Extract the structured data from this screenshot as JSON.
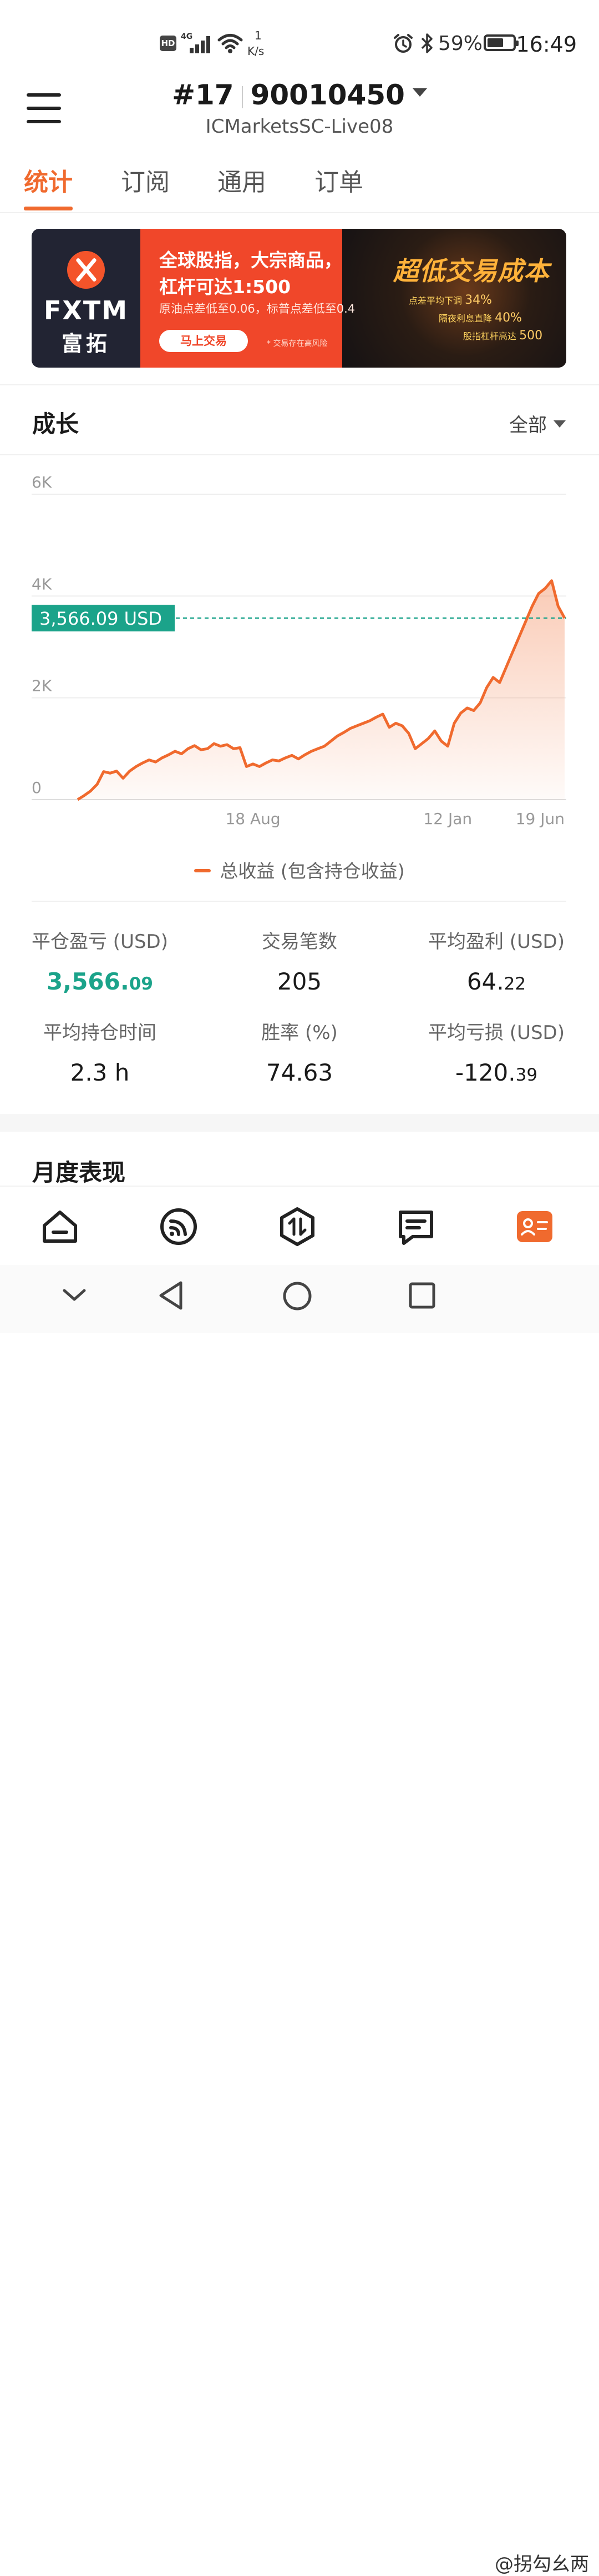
{
  "status_bar": {
    "network_hd": "HD",
    "network_type": "4G",
    "speed_value": "1",
    "speed_unit": "K/s",
    "battery": "59%",
    "time": "16:49"
  },
  "header": {
    "rank": "#17",
    "account_id": "90010450",
    "server": "ICMarketsSC-Live08"
  },
  "tabs": [
    {
      "label": "统计",
      "active": true
    },
    {
      "label": "订阅",
      "active": false
    },
    {
      "label": "通用",
      "active": false
    },
    {
      "label": "订单",
      "active": false
    }
  ],
  "banner": {
    "brand": "FXTM",
    "brand_cn": "富拓",
    "line1": "全球股指，大宗商品，",
    "line2": "杠杆可达1:500",
    "line3": "原油点差低至0.06，标普点差低至0.4",
    "button": "马上交易",
    "risk": "* 交易存在高风险",
    "headline": "超低交易成本",
    "promo": [
      {
        "text": "点差平均下调",
        "value": "34%"
      },
      {
        "text": "隔夜利息直降",
        "value": "40%"
      },
      {
        "text": "股指杠杆高达",
        "value": "500"
      }
    ]
  },
  "growth": {
    "title": "成长",
    "filter": "全部",
    "current_label": "3,566.09 USD",
    "legend": "总收益 (包含持仓收益)"
  },
  "chart_data": {
    "type": "area",
    "series": [
      {
        "name": "总收益 (包含持仓收益)",
        "color": "#f06a2e",
        "values": [
          0,
          80,
          170,
          300,
          550,
          520,
          560,
          420,
          560,
          650,
          720,
          780,
          740,
          820,
          880,
          950,
          900,
          1000,
          1060,
          980,
          1000,
          1100,
          1050,
          1080,
          1000,
          1020,
          650,
          700,
          650,
          720,
          780,
          760,
          820,
          870,
          800,
          880,
          950,
          1000,
          1050,
          1150,
          1250,
          1320,
          1400,
          1450,
          1500,
          1550,
          1620,
          1680,
          1420,
          1500,
          1450,
          1300,
          1000,
          1100,
          1200,
          1350,
          1150,
          1050,
          1500,
          1700,
          1800,
          1750,
          1900,
          2200,
          2400,
          2300,
          2600,
          2900,
          3200,
          3500,
          3800,
          4050,
          4150,
          4300,
          3800,
          3566.09
        ]
      }
    ],
    "x_tick_labels": [
      "18 Aug",
      "12 Jan",
      "19 Jun"
    ],
    "x_tick_index": [
      27,
      57,
      75
    ],
    "y_ticks": [
      0,
      2000,
      4000,
      6000
    ],
    "y_tick_labels": [
      "0",
      "2K",
      "4K",
      "6K"
    ],
    "ylim": [
      0,
      6000
    ],
    "current_value": 3566.09,
    "grid": true
  },
  "stats": [
    {
      "label": "平仓盈亏 (USD)",
      "int": "3,566.",
      "dec": "09",
      "green": true
    },
    {
      "label": "交易笔数",
      "int": "205",
      "dec": "",
      "green": false
    },
    {
      "label": "平均盈利 (USD)",
      "int": "64.",
      "dec": "22",
      "green": false
    },
    {
      "label": "平均持仓时间",
      "int": "2.3 h",
      "dec": "",
      "green": false
    },
    {
      "label": "胜率 (%)",
      "int": "74.63",
      "dec": "",
      "green": false
    },
    {
      "label": "平均亏损 (USD)",
      "int": "-120.",
      "dec": "39",
      "green": false
    }
  ],
  "monthly": {
    "title": "月度表现"
  },
  "bottom_nav": [
    {
      "name": "home-icon"
    },
    {
      "name": "signal-feed-icon"
    },
    {
      "name": "trade-icon"
    },
    {
      "name": "messages-icon"
    },
    {
      "name": "profile-card-icon",
      "active": true,
      "color": "#f06a2e"
    }
  ],
  "watermark": "@拐勾幺两"
}
